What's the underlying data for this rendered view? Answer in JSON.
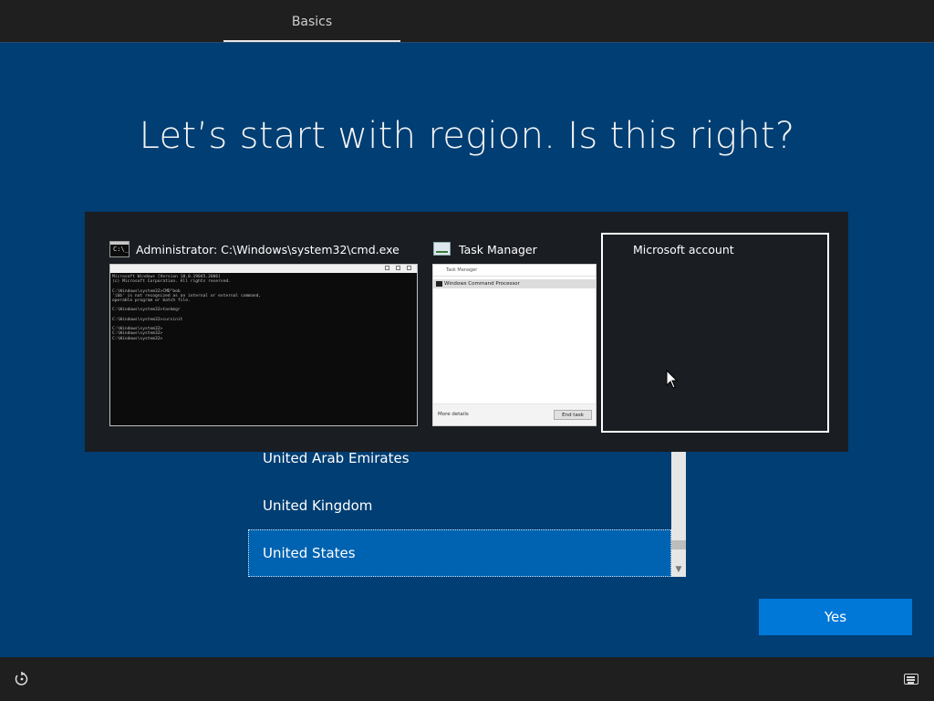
{
  "header": {
    "tab_label": "Basics"
  },
  "main": {
    "heading": "Let’s start with region. Is this right?",
    "regions": [
      "United Arab Emirates",
      "United Kingdom",
      "United States"
    ],
    "selected_region": "United States",
    "yes_label": "Yes"
  },
  "switcher": {
    "windows": [
      {
        "title": "Administrator: C:\\Windows\\system32\\cmd.exe",
        "icon": "cmd-icon"
      },
      {
        "title": "Task Manager",
        "icon": "task-manager-icon"
      },
      {
        "title": "Microsoft account",
        "icon": "microsoft-logo-icon",
        "selected": true
      }
    ],
    "cmd_preview": "Microsoft Windows [Version 10.0.19045.2006]\n(c) Microsoft Corporation. All rights reserved.\n\nC:\\Windows\\system32>CMD\"bob\n'ibb' is not recognized as an internal or external command,\noperable program or batch file.\n\nC:\\Windows\\system32>taskmgr\n\nC:\\Windows\\system32>cursinit\n\nC:\\Windows\\system32>\nC:\\Windows\\system32>\nC:\\Windows\\system32>",
    "tm_preview": {
      "title": "Task Manager",
      "process": "Windows Command Processor",
      "more_details": "More details",
      "end_task": "End task"
    }
  },
  "colors": {
    "background": "#003e73",
    "accent": "#0078d7",
    "selected_row": "#0063b1",
    "bars": "#1f1f1f"
  },
  "footer": {
    "left_icon": "accessibility-icon",
    "right_icon": "keyboard-icon"
  }
}
